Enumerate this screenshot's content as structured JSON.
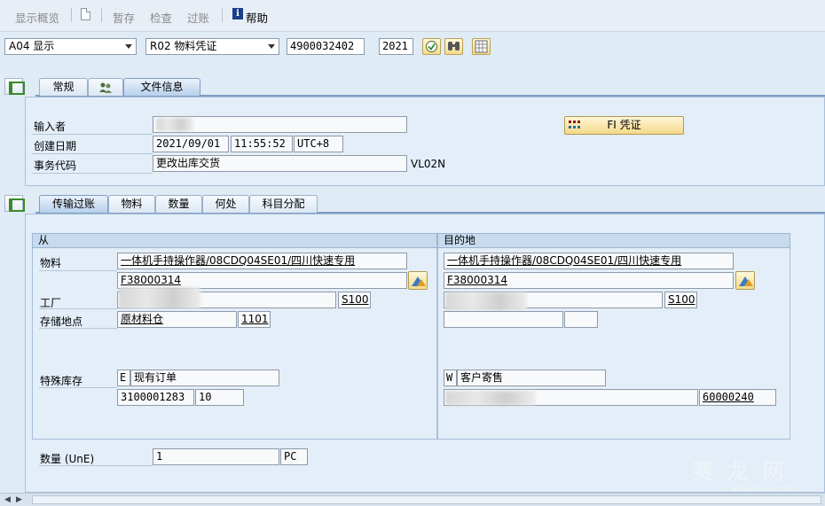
{
  "toolbar": {
    "display_overview": "显示概览",
    "save_draft": "暂存",
    "check": "检查",
    "post": "过账",
    "help": "帮助"
  },
  "header": {
    "action": "A04 显示",
    "document_type": "R02 物料凭证",
    "document_number": "4900032402",
    "year": "2021"
  },
  "top_tabs": [
    {
      "label": "常规"
    },
    {
      "label": ""
    },
    {
      "label": "文件信息"
    }
  ],
  "doc_info": {
    "entered_by_label": "输入者",
    "created_date_label": "创建日期",
    "created_date": "2021/09/01",
    "created_time": "11:55:52",
    "timezone": "UTC+8",
    "transaction_label": "事务代码",
    "transaction_text": "更改出库交货",
    "transaction_code": "VL02N",
    "fi_button": "FI 凭证"
  },
  "item_tabs": [
    {
      "label": "传输过账"
    },
    {
      "label": "物料"
    },
    {
      "label": "数量"
    },
    {
      "label": "何处"
    },
    {
      "label": "科目分配"
    }
  ],
  "from": {
    "header": "从",
    "material_label": "物料",
    "material_desc": "一体机手持操作器/08CDQ04SE01/四川快速专用",
    "material_no": "F38000314",
    "plant_label": "工厂",
    "plant_code": "S100",
    "sloc_label": "存储地点",
    "sloc_name": "原材料仓",
    "sloc_code": "1101",
    "special_stock_label": "特殊库存",
    "special_stock_ind": "E",
    "special_stock_text": "现有订单",
    "sales_order": "3100001283",
    "sales_item": "10"
  },
  "to": {
    "header": "目的地",
    "material_desc": "一体机手持操作器/08CDQ04SE01/四川快速专用",
    "material_no": "F38000314",
    "plant_code": "S100",
    "special_stock_ind": "W",
    "special_stock_text": "客户寄售",
    "customer": "60000240"
  },
  "quantity": {
    "label": "数量 (UnE)",
    "value": "1",
    "unit": "PC"
  },
  "watermark": {
    "text": "赛 龙 网",
    "url": "www.91sai.com"
  }
}
